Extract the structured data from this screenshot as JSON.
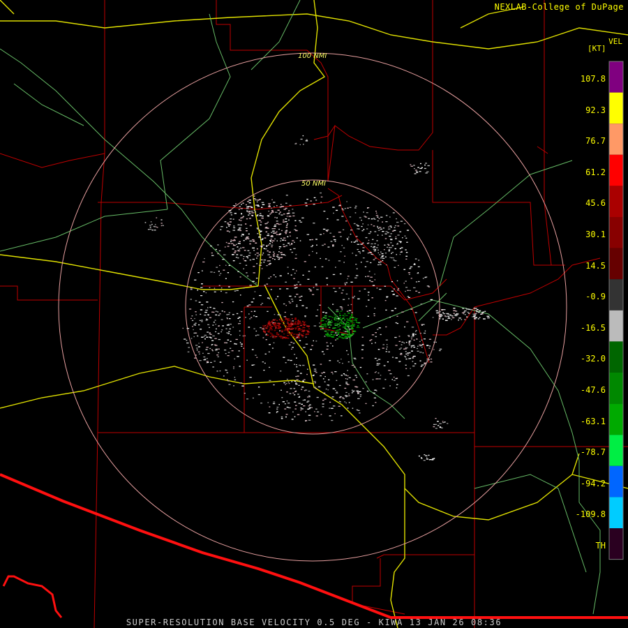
{
  "header": {
    "credit": "NEXLAB-College of DuPage",
    "product_short": "VEL",
    "unit": "[KT]"
  },
  "range_rings": [
    "100 NMI",
    "50 NMI"
  ],
  "color_scale": {
    "labels": [
      "107.8",
      "92.3",
      "76.7",
      "61.2",
      "45.6",
      "30.1",
      "14.5",
      "-0.9",
      "-16.5",
      "-32.0",
      "-47.6",
      "-63.1",
      "-78.7",
      "-94.2",
      "-109.8",
      "TH"
    ],
    "colors": [
      "#800080",
      "#ffff00",
      "#ff9966",
      "#ff0000",
      "#aa0000",
      "#880000",
      "#660000",
      "#333333",
      "#bbbbbb",
      "#006600",
      "#008800",
      "#00aa00",
      "#00ee44",
      "#0066ff",
      "#00ccff",
      "#2a0020"
    ]
  },
  "footer": "SUPER-RESOLUTION BASE VELOCITY 0.5 DEG - KIWA 13 JAN 26 08:36"
}
